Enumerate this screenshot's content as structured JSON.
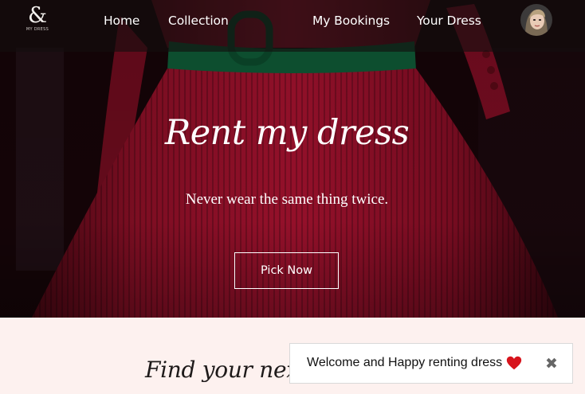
{
  "brand": {
    "logo_symbol": "&",
    "logo_text": "MY DRESS"
  },
  "nav": {
    "items": [
      {
        "label": "Home"
      },
      {
        "label": "Collection"
      },
      {
        "label": "My Bookings"
      },
      {
        "label": "Your Dress"
      }
    ],
    "avatar_icon": "user-avatar"
  },
  "hero": {
    "title": "Rent my dress",
    "tagline": "Never wear the same thing twice.",
    "cta_label": "Pick Now"
  },
  "section": {
    "title": "Find your next m"
  },
  "toast": {
    "message": "Welcome and Happy renting dress",
    "heart_icon": "heart-icon",
    "close_symbol": "✖"
  },
  "colors": {
    "dress_red": "#9c0f2c",
    "belt_green": "#0f5a36",
    "page_bg": "#fdf1ef",
    "nav_bg": "#140e0f"
  }
}
